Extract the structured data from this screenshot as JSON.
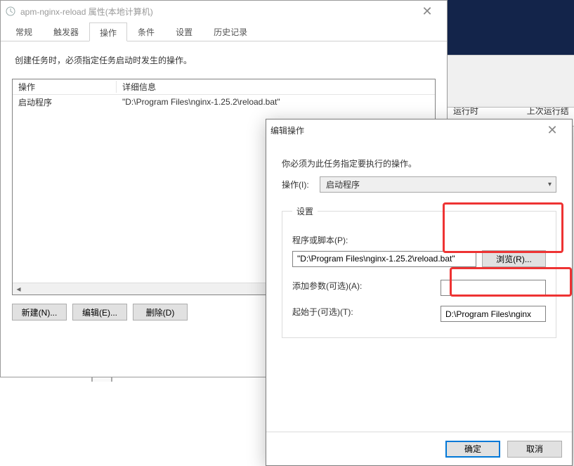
{
  "bg": {
    "col1": "运行时间",
    "col2": "上次运行结果"
  },
  "props": {
    "title": "apm-nginx-reload 属性(本地计算机)",
    "tabs": {
      "general": "常规",
      "triggers": "触发器",
      "actions": "操作",
      "conditions": "条件",
      "settings": "设置",
      "history": "历史记录"
    },
    "desc": "创建任务时，必须指定任务启动时发生的操作。",
    "th_action": "操作",
    "th_detail": "详细信息",
    "row_action": "启动程序",
    "row_detail": "\"D:\\Program Files\\nginx-1.25.2\\reload.bat\"",
    "btn_new": "新建(N)...",
    "btn_edit": "编辑(E)...",
    "btn_delete": "删除(D)"
  },
  "edit": {
    "title": "编辑操作",
    "must": "你必须为此任务指定要执行的操作。",
    "action_label": "操作(I):",
    "action_value": "启动程序",
    "settings_legend": "设置",
    "program_label": "程序或脚本(P):",
    "program_value": "\"D:\\Program Files\\nginx-1.25.2\\reload.bat\"",
    "browse": "浏览(R)...",
    "args_label": "添加参数(可选)(A):",
    "args_value": "",
    "startin_label": "起始于(可选)(T):",
    "startin_value": "D:\\Program Files\\nginx",
    "ok": "确定",
    "cancel": "取消"
  }
}
